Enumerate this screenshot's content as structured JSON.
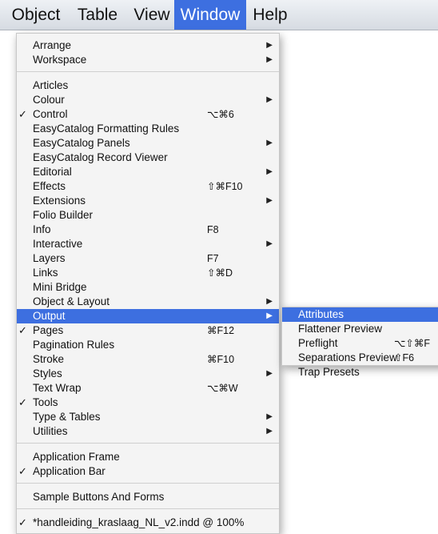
{
  "menubar": {
    "items": [
      "Object",
      "Table",
      "View",
      "Window",
      "Help"
    ]
  },
  "window_menu": {
    "items": [
      {
        "label": "Arrange",
        "submenu": true
      },
      {
        "label": "Workspace",
        "submenu": true
      },
      {
        "label": "Articles"
      },
      {
        "label": "Colour",
        "submenu": true
      },
      {
        "label": "Control",
        "checked": true,
        "shortcut": "⌥⌘6"
      },
      {
        "label": "EasyCatalog Formatting Rules"
      },
      {
        "label": "EasyCatalog Panels",
        "submenu": true
      },
      {
        "label": "EasyCatalog Record Viewer"
      },
      {
        "label": "Editorial",
        "submenu": true
      },
      {
        "label": "Effects",
        "shortcut": "⇧⌘F10"
      },
      {
        "label": "Extensions",
        "submenu": true
      },
      {
        "label": "Folio Builder"
      },
      {
        "label": "Info",
        "shortcut": "F8"
      },
      {
        "label": "Interactive",
        "submenu": true
      },
      {
        "label": "Layers",
        "shortcut": "F7"
      },
      {
        "label": "Links",
        "shortcut": "⇧⌘D"
      },
      {
        "label": "Mini Bridge"
      },
      {
        "label": "Object & Layout",
        "submenu": true
      },
      {
        "label": "Output",
        "submenu": true,
        "highlighted": true
      },
      {
        "label": "Pages",
        "checked": true,
        "shortcut": "⌘F12"
      },
      {
        "label": "Pagination Rules"
      },
      {
        "label": "Stroke",
        "shortcut": "⌘F10"
      },
      {
        "label": "Styles",
        "submenu": true
      },
      {
        "label": "Text Wrap",
        "shortcut": "⌥⌘W"
      },
      {
        "label": "Tools",
        "checked": true
      },
      {
        "label": "Type & Tables",
        "submenu": true
      },
      {
        "label": "Utilities",
        "submenu": true
      },
      {
        "label": "Application Frame"
      },
      {
        "label": "Application Bar",
        "checked": true
      },
      {
        "label": "Sample Buttons And Forms"
      },
      {
        "label": "*handleiding_kraslaag_NL_v2.indd @ 100%",
        "checked": true
      }
    ]
  },
  "output_submenu": {
    "items": [
      {
        "label": "Attributes",
        "highlighted": true
      },
      {
        "label": "Flattener Preview"
      },
      {
        "label": "Preflight",
        "shortcut": "⌥⇧⌘F"
      },
      {
        "label": "Separations Preview",
        "shortcut": "⇧F6"
      },
      {
        "label": "Trap Presets"
      }
    ]
  },
  "glyphs": {
    "check": "✓",
    "arrow": "▶"
  },
  "colors": {
    "highlight": "#3d6fe0"
  }
}
